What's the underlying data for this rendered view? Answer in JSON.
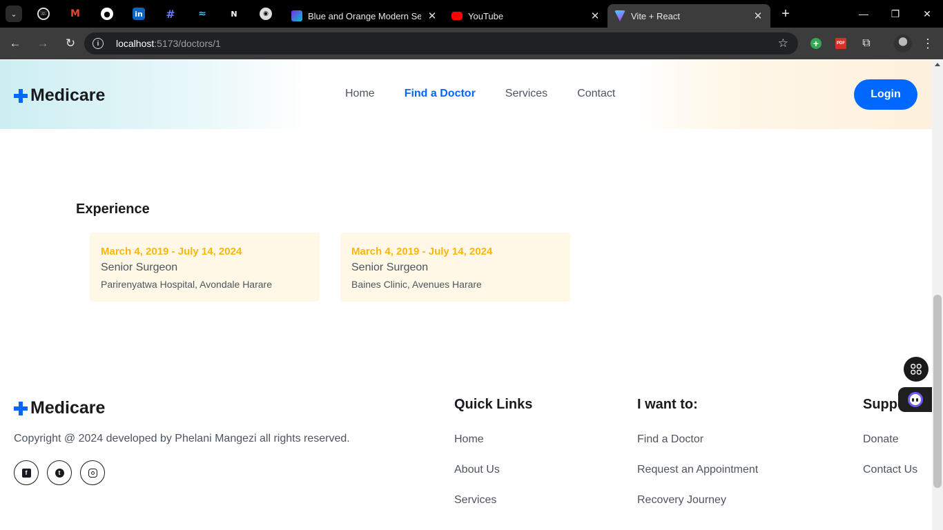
{
  "browser": {
    "pinned_tabs": [
      "whatsapp-icon",
      "gmail-icon",
      "github-icon",
      "linkedin-icon",
      "hashtag-icon",
      "tailwind-icon",
      "next-icon",
      "chat-icon"
    ],
    "tabs": [
      {
        "title": "Blue and Orange Modern Sellin",
        "favicon": "canva-icon",
        "active": false
      },
      {
        "title": "YouTube",
        "favicon": "youtube-icon",
        "active": false
      },
      {
        "title": "Vite + React",
        "favicon": "vite-icon",
        "active": true
      }
    ],
    "url_host": "localhost",
    "url_path": ":5173/doctors/1"
  },
  "site": {
    "brand": "Medicare",
    "nav": [
      "Home",
      "Find a Doctor",
      "Services",
      "Contact"
    ],
    "nav_active": "Find a Doctor",
    "login_label": "Login",
    "accent": "#0067ff"
  },
  "experience": {
    "heading": "Experience",
    "items": [
      {
        "dates": "March 4, 2019 - July 14, 2024",
        "role": "Senior Surgeon",
        "place": "Parirenyatwa Hospital, Avondale Harare"
      },
      {
        "dates": "March 4, 2019 - July 14, 2024",
        "role": "Senior Surgeon",
        "place": "Baines Clinic, Avenues Harare"
      }
    ]
  },
  "footer": {
    "brand": "Medicare",
    "copyright": "Copyright @ 2024 developed by Phelani Mangezi all rights reserved.",
    "social": [
      "facebook-icon",
      "twitter-icon",
      "instagram-icon"
    ],
    "columns": [
      {
        "heading": "Quick Links",
        "links": [
          "Home",
          "About Us",
          "Services"
        ]
      },
      {
        "heading": "I want to:",
        "links": [
          "Find a Doctor",
          "Request an Appointment",
          "Recovery Journey"
        ]
      },
      {
        "heading": "Suppo",
        "links": [
          "Donate",
          "Contact Us"
        ]
      }
    ]
  }
}
